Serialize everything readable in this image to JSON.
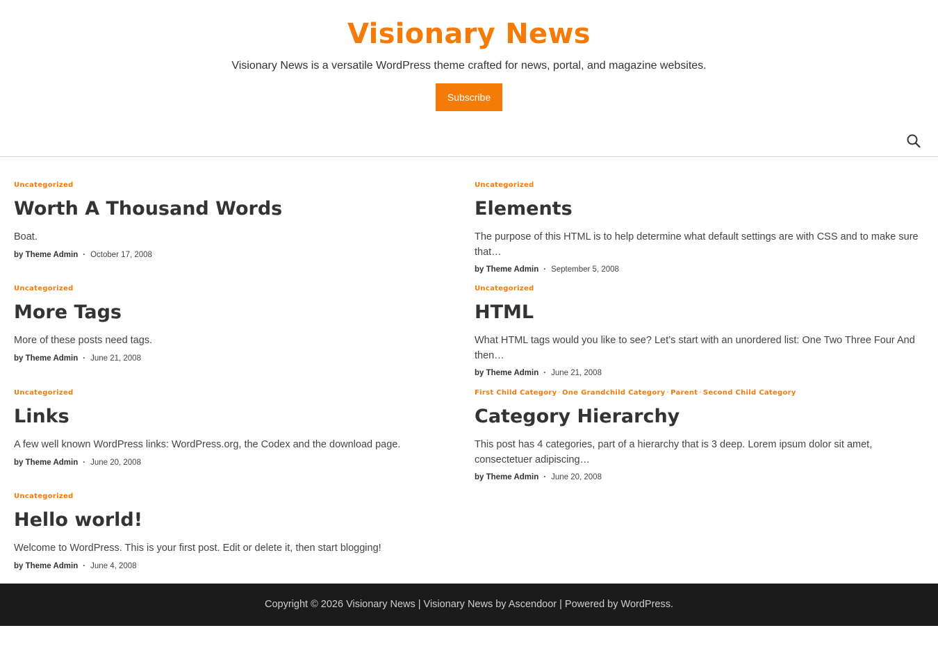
{
  "header": {
    "site_title": "Visionary News",
    "site_description": "Visionary News is a versatile WordPress theme crafted for news, portal, and magazine websites.",
    "subscribe_label": "Subscribe",
    "search_icon": "search-icon"
  },
  "posts": [
    {
      "categories": [
        "Uncategorized"
      ],
      "title": "Worth A Thousand Words",
      "excerpt": "Boat.",
      "author": "by Theme Admin",
      "date": "October 17, 2008"
    },
    {
      "categories": [
        "Uncategorized"
      ],
      "title": "Elements",
      "excerpt": "The purpose of this HTML is to help determine what default settings are with CSS and to make sure that…",
      "author": "by Theme Admin",
      "date": "September 5, 2008"
    },
    {
      "categories": [
        "Uncategorized"
      ],
      "title": "More Tags",
      "excerpt": "More of these posts need tags.",
      "author": "by Theme Admin",
      "date": "June 21, 2008"
    },
    {
      "categories": [
        "Uncategorized"
      ],
      "title": "HTML",
      "excerpt": "What HTML tags would you like to see? Let’s start with an unordered list: One Two Three Four And then…",
      "author": "by Theme Admin",
      "date": "June 21, 2008"
    },
    {
      "categories": [
        "Uncategorized"
      ],
      "title": "Links",
      "excerpt": "A few well known WordPress links: WordPress.org, the Codex and the download page.",
      "author": "by Theme Admin",
      "date": "June 20, 2008"
    },
    {
      "categories": [
        "First Child Category",
        "One Grandchild Category",
        "Parent",
        "Second Child Category"
      ],
      "title": "Category Hierarchy",
      "excerpt": "This post has 4 categories, part of a hierarchy that is 3 deep. Lorem ipsum dolor sit amet, consectetuer adipiscing…",
      "author": "by Theme Admin",
      "date": "June 20, 2008"
    },
    {
      "categories": [
        "Uncategorized"
      ],
      "title": "Hello world!",
      "excerpt": "Welcome to WordPress. This is your first post. Edit or delete it, then start blogging!",
      "author": "by Theme Admin",
      "date": "June 4, 2008"
    }
  ],
  "footer": {
    "text": "Copyright © 2026 Visionary News | Visionary News by Ascendoor | Powered by WordPress."
  },
  "colors": {
    "accent": "#f47b07",
    "footer_bg": "#1b1b1b"
  }
}
